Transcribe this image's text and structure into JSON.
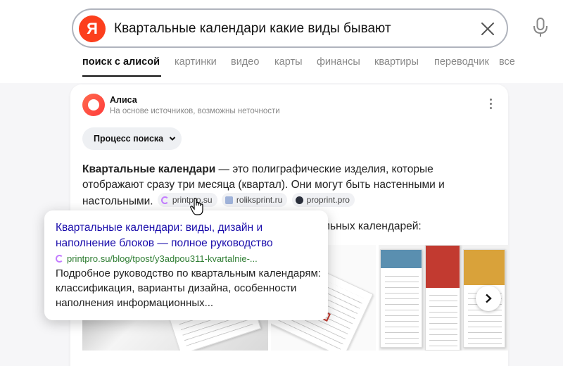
{
  "search": {
    "logo_letter": "Я",
    "query": "Квартальные календари какие виды бывают"
  },
  "tabs": [
    {
      "label": "поиск с алисой",
      "active": true
    },
    {
      "label": "картинки"
    },
    {
      "label": "видео"
    },
    {
      "label": "карты"
    },
    {
      "label": "финансы"
    },
    {
      "label": "квартиры"
    },
    {
      "label": "переводчик"
    },
    {
      "label": "все"
    }
  ],
  "alice": {
    "name": "Алиса",
    "subtitle": "На основе источников, возможны неточности",
    "process_button": "Процесс поиска"
  },
  "answer": {
    "term": "Квартальные календари",
    "text": " — это полиграфические изделия, которые отображают сразу три месяца (квартал). Они могут быть настенными и настольными.",
    "sources": [
      "printpro.su",
      "roliksprint.ru",
      "proprint.pro"
    ],
    "types_fragment": "льных календарей:"
  },
  "popup": {
    "title": "Квартальные календари: виды, дизайн и наполнение блоков — полное руководство",
    "url": "printpro.su/blog/tpost/y3adpou311-kvartalnie-...",
    "description": "Подробное руководство по квартальным календарям: классификация, варианты дизайна, особенности наполнения информационных..."
  },
  "colors": {
    "brand": "#fc3f1d",
    "link": "#1a0dab",
    "url": "#2e7d32"
  }
}
